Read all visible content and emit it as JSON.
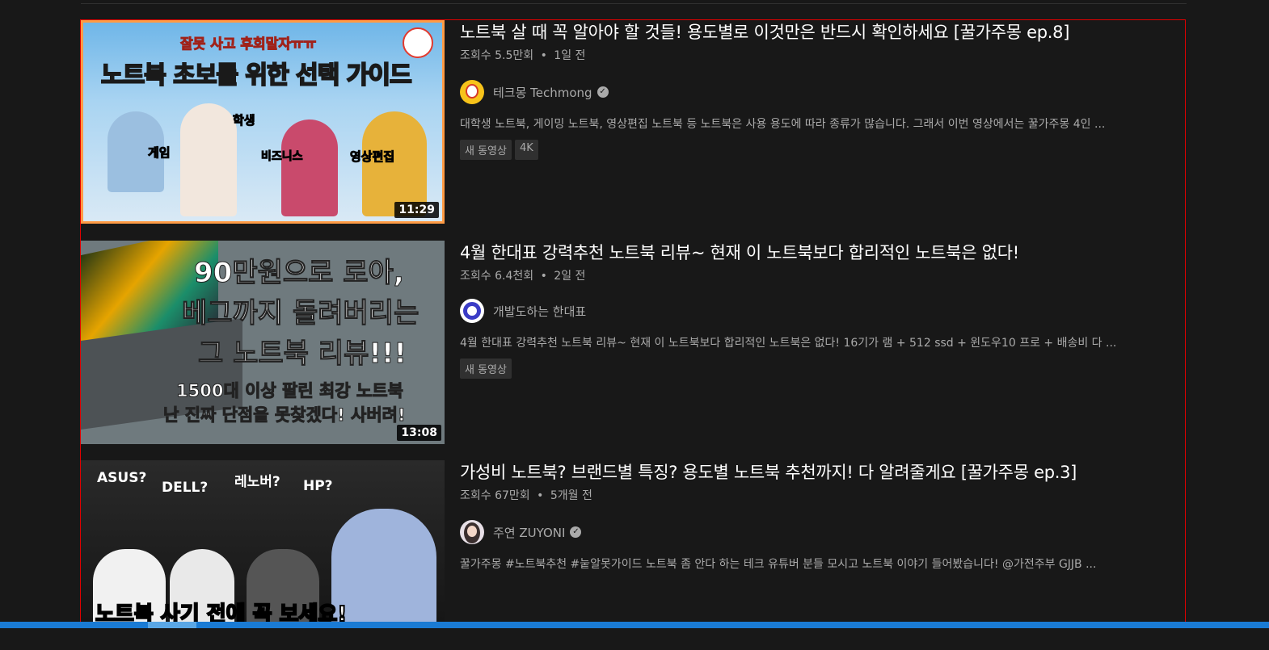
{
  "results": [
    {
      "title": "노트북 살 때 꼭 알아야 할 것들! 용도별로 이것만은 반드시 확인하세요 [꿀가주몽 ep.8]",
      "views": "조회수 5.5만회",
      "age": "1일 전",
      "channel": "테크몽 Techmong",
      "verified": true,
      "description": "대학생 노트북, 게이밍 노트북, 영상편집 노트북 등 노트북은 사용 용도에 따라 종류가 많습니다. 그래서 이번 영상에서는 꿀가주몽 4인 ...",
      "badges": [
        "새 동영상",
        "4K"
      ],
      "duration": "11:29",
      "thumb_text": {
        "top": "잘못 사고 후회말자ㅠㅠ",
        "headline": "노트북 초보를 위한 선택 가이드",
        "labels": [
          "게임",
          "학생",
          "비즈니스",
          "영상편집"
        ]
      }
    },
    {
      "title": "4월 한대표 강력추천 노트북 리뷰~ 현재 이 노트북보다 합리적인 노트북은 없다!",
      "views": "조회수 6.4천회",
      "age": "2일 전",
      "channel": "개발도하는 한대표",
      "verified": false,
      "description": "4월 한대표 강력추천 노트북 리뷰~ 현재 이 노트북보다 합리적인 노트북은 없다! 16기가 램 + 512 ssd + 윈도우10 프로 + 배송비 다 ...",
      "badges": [
        "새 동영상"
      ],
      "duration": "13:08",
      "thumb_text": {
        "lines": [
          "90만원으로 로아,",
          "베그까지 돌려버리는",
          "그 노트북 리뷰!!!"
        ],
        "sub": [
          "1500대 이상 팔린 최강 노트북",
          "난 진짜 단점을 못찾겠다! 사버려!"
        ]
      }
    },
    {
      "title": "가성비 노트북? 브랜드별 특징? 용도별 노트북 추천까지! 다 알려줄게요 [꿀가주몽 ep.3]",
      "views": "조회수 67만회",
      "age": "5개월 전",
      "channel": "주연 ZUYONI",
      "verified": true,
      "description": "꿀가주몽 #노트북추천 #눝알못가이드 노트북 좀 안다 하는 테크 유튜버 분들 모시고 노트북 이야기 들어봤습니다! @가전주부 GJJB ...",
      "badges": [],
      "duration": "",
      "thumb_text": {
        "labels": [
          "ASUS?",
          "DELL?",
          "레노버?",
          "HP?"
        ],
        "bottom": "노트북 사기 전에 꼭 보세요!"
      }
    }
  ],
  "meta_separator": "•",
  "colors": {
    "selection_border": "#e00000",
    "thumb_highlight": "#ff9b45",
    "background": "#181818"
  }
}
